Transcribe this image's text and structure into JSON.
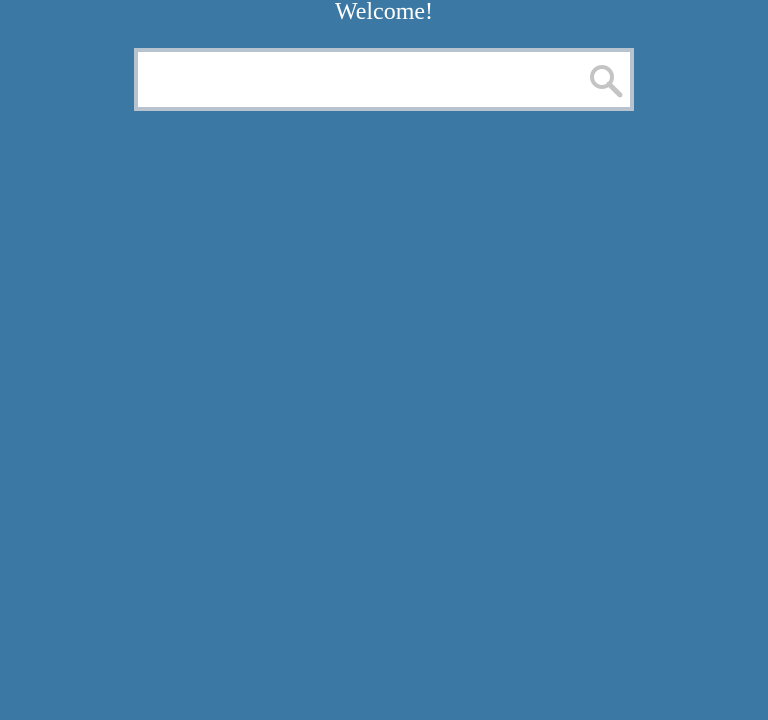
{
  "header": {
    "title": "Welcome!"
  },
  "search": {
    "value": "",
    "placeholder": "",
    "button_icon": "search-icon"
  },
  "colors": {
    "background": "#3b78a3",
    "title_text": "#ffffff",
    "search_border": "#b7c3ce",
    "search_icon": "#c4c4c4"
  }
}
